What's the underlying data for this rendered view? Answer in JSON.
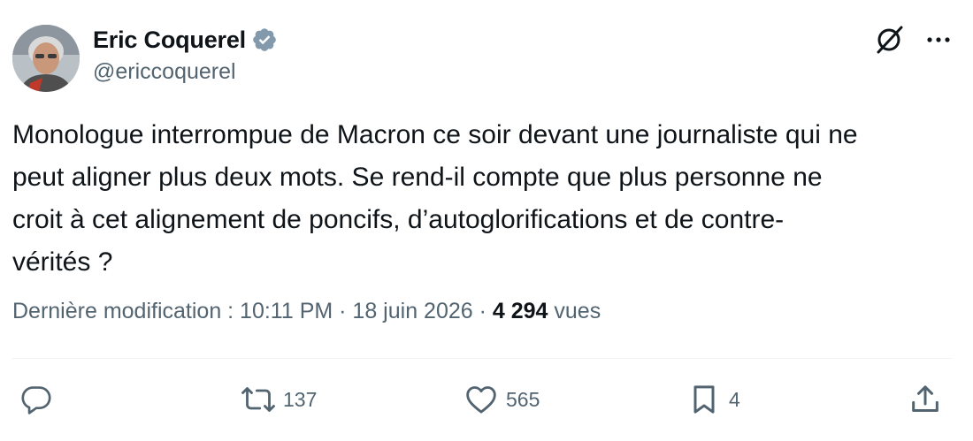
{
  "author": {
    "display_name": "Eric Coquerel",
    "handle": "@ericcoquerel",
    "verified_color": "#829aab"
  },
  "tweet": {
    "text_lines": [
      "Monologue interrompue de Macron ce soir devant une journaliste qui ne",
      "peut aligner plus deux mots. Se rend-il compte que plus personne ne",
      "croit à cet alignement de poncifs, d’autoglorifications et de contre-",
      "vérités ?"
    ]
  },
  "meta": {
    "edited_label": "Dernière modification : 10:11 PM · 18 juin 2026 · ",
    "views_count": "4 294",
    "views_label": " vues"
  },
  "actions": {
    "reply_icon": "reply-icon",
    "retweet_icon": "retweet-icon",
    "retweet_count": "137",
    "like_icon": "heart-icon",
    "like_count": "565",
    "bookmark_icon": "bookmark-icon",
    "bookmark_count": "4",
    "share_icon": "share-icon"
  },
  "top_icons": [
    "grok-icon",
    "more-icon"
  ],
  "colors": {
    "text": "#0f1419",
    "secondary": "#536471",
    "divider": "#eff3f4"
  }
}
